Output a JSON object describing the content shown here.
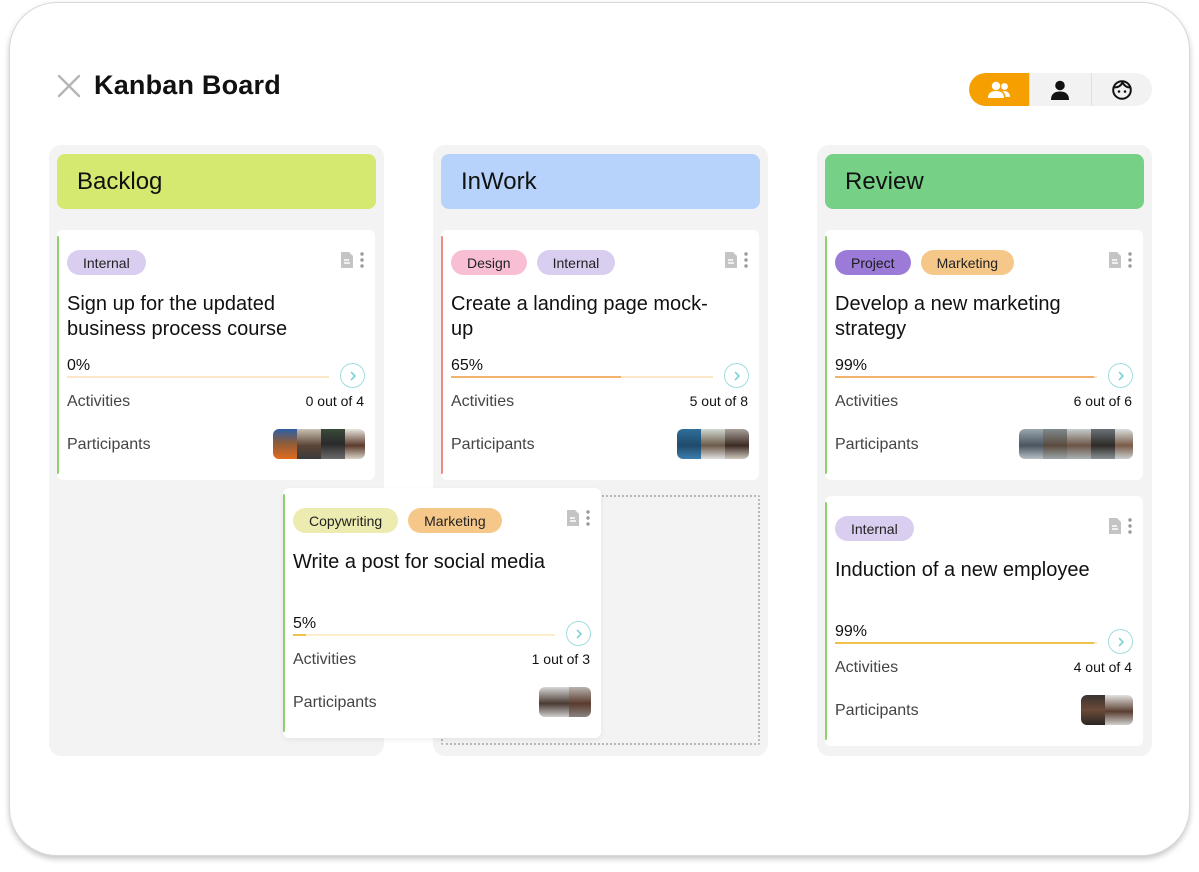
{
  "header": {
    "title": "Kanban Board",
    "view_switch": [
      {
        "icon": "team-icon",
        "active": true
      },
      {
        "icon": "user-icon",
        "active": false
      },
      {
        "icon": "face-icon",
        "active": false
      }
    ]
  },
  "colors": {
    "accent": "#f5a000",
    "backlog": "#d5e86f",
    "inwork": "#b7d3fb",
    "review": "#76d187"
  },
  "labels": {
    "activities": "Activities",
    "participants": "Participants"
  },
  "columns": [
    {
      "title": "Backlog"
    },
    {
      "title": "InWork"
    },
    {
      "title": "Review"
    }
  ],
  "cards": {
    "backlog_1": {
      "tags": [
        "Internal"
      ],
      "title": "Sign up for the updated business process course",
      "progress": "0%",
      "progress_value": 0,
      "activities": "0 out of 4"
    },
    "inwork_1": {
      "tags": [
        "Design",
        "Internal"
      ],
      "title": "Create a landing page mock-up",
      "progress": "65%",
      "progress_value": 65,
      "activities": "5 out of 8"
    },
    "dragging": {
      "tags": [
        "Copywriting",
        "Marketing"
      ],
      "title": "Write a post for social media",
      "progress": "5%",
      "progress_value": 5,
      "activities": "1 out of 3"
    },
    "review_1": {
      "tags": [
        "Project",
        "Marketing"
      ],
      "title": "Develop a new marketing strategy",
      "progress": "99%",
      "progress_value": 99,
      "activities": "6 out of 6"
    },
    "review_2": {
      "tags": [
        "Internal"
      ],
      "title": "Induction of a new employee",
      "progress": "99%",
      "progress_value": 99,
      "activities": "4 out of 4"
    }
  }
}
